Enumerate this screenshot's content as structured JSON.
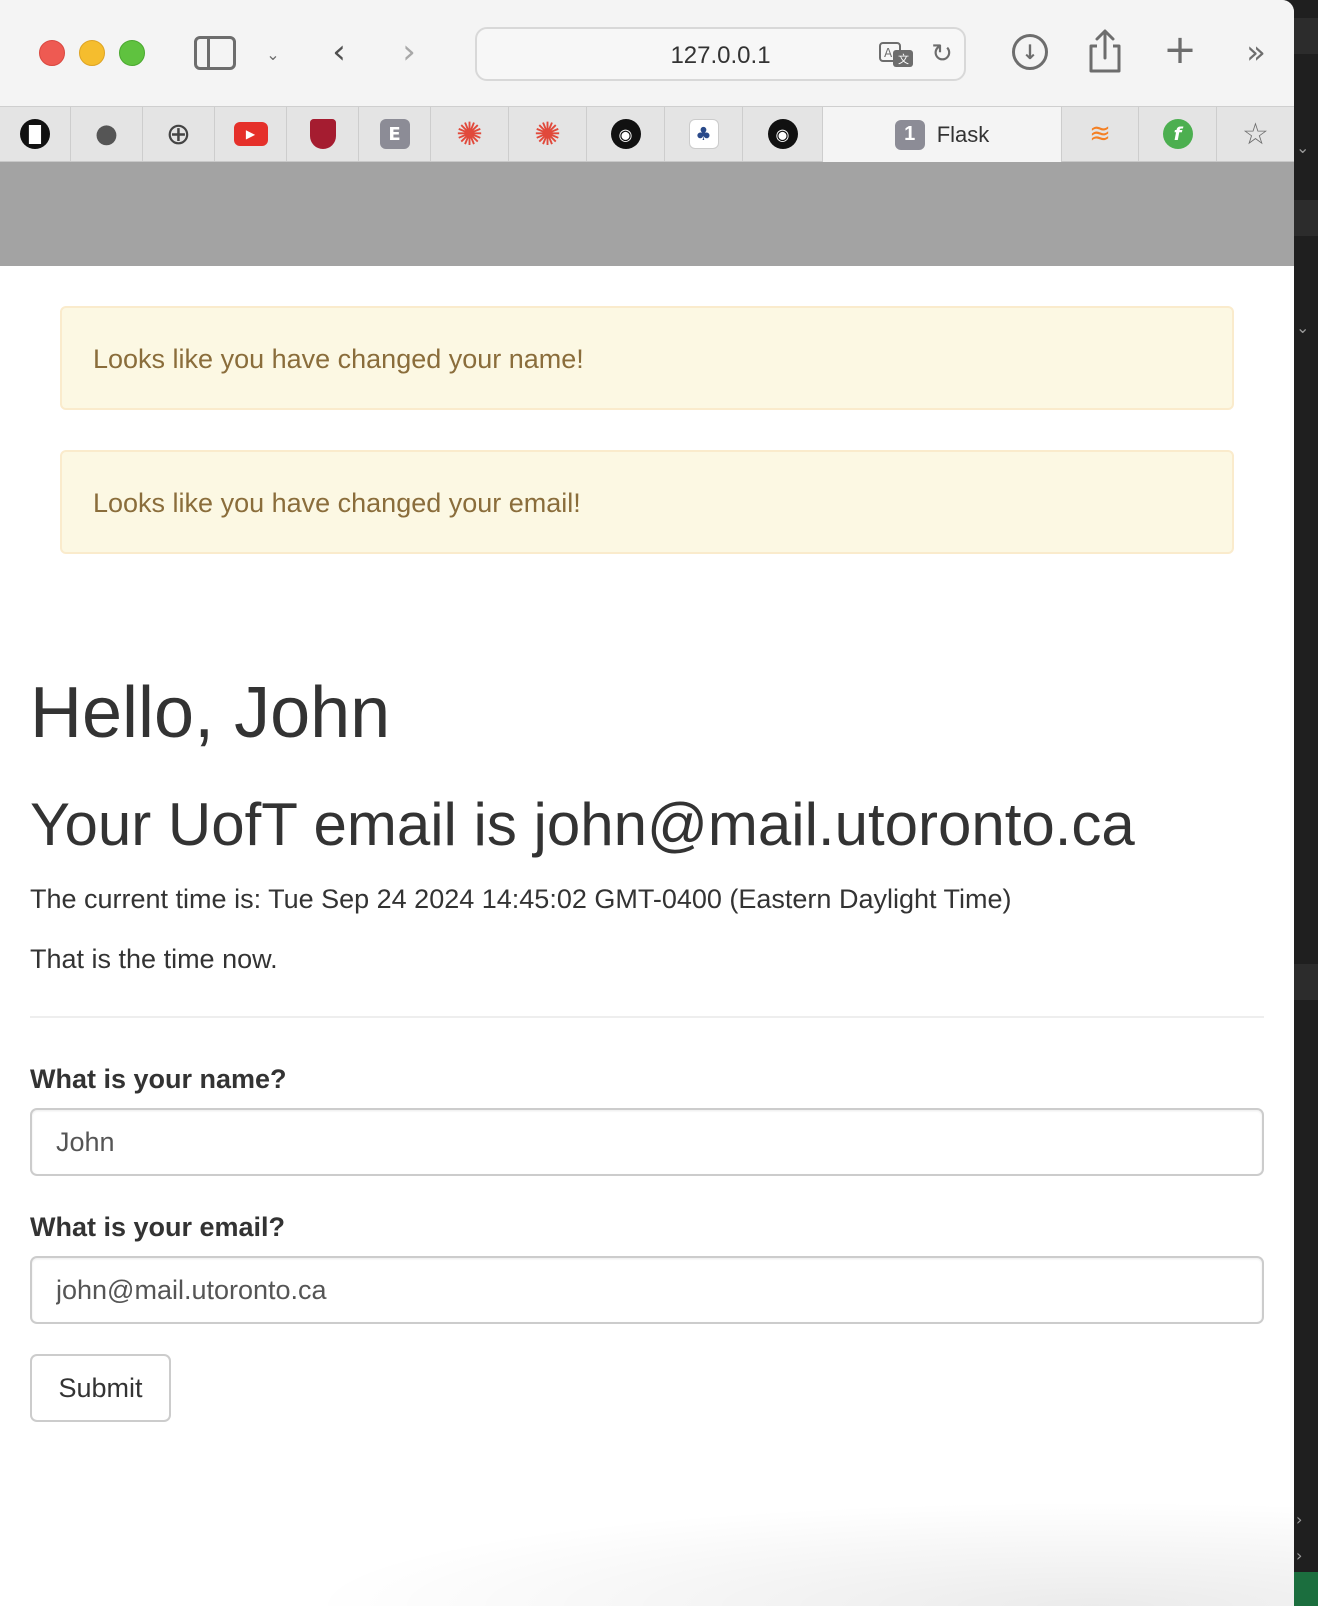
{
  "browser": {
    "url": "127.0.0.1",
    "active_tab": {
      "badge": "1",
      "label": "Flask"
    },
    "favorites": [
      {
        "icon": "medium-icon",
        "badge": ""
      },
      {
        "icon": "apple-icon",
        "badge": ""
      },
      {
        "icon": "globe-icon",
        "badge": ""
      },
      {
        "icon": "youtube-icon",
        "badge": ""
      },
      {
        "icon": "harvard-shield-icon",
        "badge": ""
      },
      {
        "icon": "e-badge-icon",
        "badge": "E"
      },
      {
        "icon": "canvas-icon",
        "badge": ""
      },
      {
        "icon": "canvas-icon",
        "badge": ""
      },
      {
        "icon": "github-icon",
        "badge": ""
      },
      {
        "icon": "tree-logo-icon",
        "badge": ""
      },
      {
        "icon": "github-icon",
        "badge": ""
      },
      {
        "icon": "stackoverflow-icon",
        "badge": ""
      },
      {
        "icon": "green-f-icon",
        "badge": ""
      },
      {
        "icon": "star-icon",
        "badge": ""
      }
    ]
  },
  "alerts": [
    "Looks like you have changed your name!",
    "Looks like you have changed your email!"
  ],
  "page": {
    "greeting": "Hello, John",
    "email_heading": "Your UofT email is john@mail.utoronto.ca",
    "current_time": "The current time is: Tue Sep 24 2024 14:45:02 GMT-0400 (Eastern Daylight Time)",
    "time_note": "That is the time now."
  },
  "form": {
    "name_label": "What is your name?",
    "name_value": "John",
    "email_label": "What is your email?",
    "email_value": "john@mail.utoronto.ca",
    "submit_label": "Submit"
  },
  "colors": {
    "alert_bg": "#fcf8e3",
    "alert_border": "#faebcc",
    "alert_text": "#8a6d3b",
    "navbar": "#a3a3a3"
  }
}
